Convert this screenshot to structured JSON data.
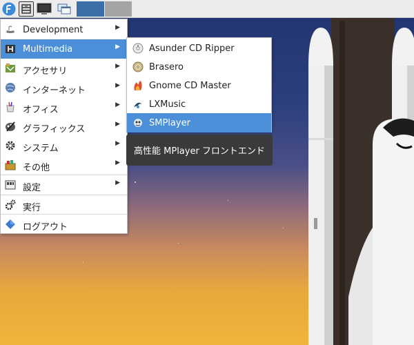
{
  "taskbar": {
    "start_icon": "fedora-logo-icon",
    "launchers": [
      "file-manager-icon",
      "terminal-icon",
      "window-switcher-icon"
    ],
    "colors": {
      "window_active": "#3c6ea8",
      "window_inactive": "#a4a4a4"
    }
  },
  "main_menu": {
    "items": [
      {
        "label": "Development",
        "icon": "development-icon",
        "submenu": true
      },
      {
        "label": "Multimedia",
        "icon": "multimedia-icon",
        "submenu": true,
        "active": true
      },
      {
        "label": "アクセサリ",
        "icon": "accessories-icon",
        "submenu": true
      },
      {
        "label": "インターネット",
        "icon": "internet-icon",
        "submenu": true
      },
      {
        "label": "オフィス",
        "icon": "office-icon",
        "submenu": true
      },
      {
        "label": "グラフィックス",
        "icon": "graphics-icon",
        "submenu": true
      },
      {
        "label": "システム",
        "icon": "system-gear-icon",
        "submenu": true
      },
      {
        "label": "その他",
        "icon": "other-icon",
        "submenu": true
      },
      {
        "label": "設定",
        "icon": "settings-icon",
        "submenu": true
      },
      {
        "label": "実行",
        "icon": "run-icon",
        "submenu": false
      },
      {
        "label": "ログアウト",
        "icon": "logout-icon",
        "submenu": false
      }
    ],
    "submenu_arrow": "▶"
  },
  "multimedia_submenu": {
    "items": [
      {
        "label": "Asunder CD Ripper",
        "icon": "cd-ripper-icon"
      },
      {
        "label": "Brasero",
        "icon": "brasero-disc-icon"
      },
      {
        "label": "Gnome CD Master",
        "icon": "gnome-cd-master-icon"
      },
      {
        "label": "LXMusic",
        "icon": "lxmusic-icon"
      },
      {
        "label": "SMPlayer",
        "icon": "smplayer-icon",
        "active": true
      }
    ]
  },
  "tooltip": {
    "text": "高性能 MPlayer フロントエンド"
  },
  "colors": {
    "highlight": "#4a8fd8",
    "tooltip_bg": "#3a3a3a"
  }
}
